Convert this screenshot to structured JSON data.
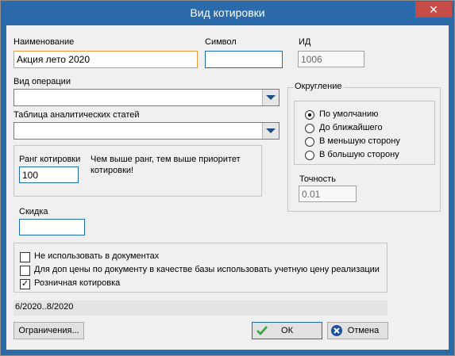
{
  "window": {
    "title": "Вид котировки",
    "close_glyph": "✕"
  },
  "name": {
    "label": "Наименование",
    "value": "Акция лето 2020"
  },
  "symbol": {
    "label": "Символ",
    "value": ""
  },
  "id": {
    "label": "ИД",
    "value": "1006"
  },
  "operation": {
    "label": "Вид операции",
    "value": ""
  },
  "analytics": {
    "label": "Таблица аналитических статей",
    "value": ""
  },
  "rank": {
    "label": "Ранг котировки",
    "value": "100",
    "hint": "Чем выше ранг, тем выше приоритет котировки!"
  },
  "discount": {
    "label": "Скидка",
    "value": ""
  },
  "rounding": {
    "label": "Округление",
    "options": [
      "По умолчанию",
      "До ближайшего",
      "В меньшую сторону",
      "В большую сторону"
    ],
    "selected": "По умолчанию"
  },
  "precision": {
    "label": "Точность",
    "value": "0.01"
  },
  "checkboxes": [
    {
      "label": "Не использовать в документах",
      "checked": false
    },
    {
      "label": "Для доп цены по документу в качестве базы использовать учетную цену реализации",
      "checked": false
    },
    {
      "label": "Розничная котировка",
      "checked": true
    }
  ],
  "status": {
    "text": "6/2020..8/2020"
  },
  "buttons": {
    "restrictions": "Ограничения...",
    "ok": "ОК",
    "cancel": "Отмена"
  },
  "icons": {
    "ok": "check-icon",
    "cancel": "cancel-icon",
    "dropdown": "chevron-down-icon"
  },
  "colors": {
    "title_bar": "#2b6bab",
    "close": "#c74b46",
    "ok_check": "#35a33a",
    "cancel_circle": "#1f4f9c",
    "focus_border": "#e79a3a"
  }
}
